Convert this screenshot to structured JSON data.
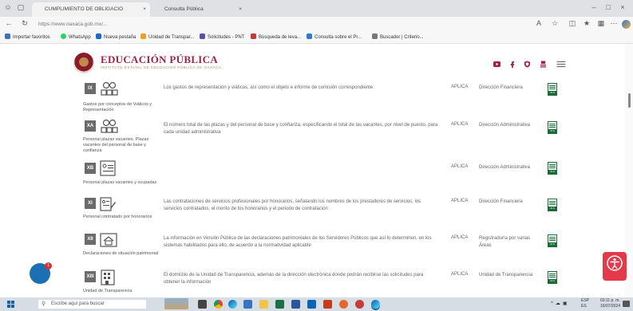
{
  "browser": {
    "tabs": [
      {
        "label": "CUMPLIMIENTO DE OBLIGACIO"
      },
      {
        "label": "Consulta Pública"
      }
    ],
    "new_tab_label": "+",
    "url": "https://www.oaxaca.gob.mx/...",
    "bookmarks": [
      {
        "label": "Importar favoritos",
        "color": "#3b73b9"
      },
      {
        "label": "WhatsApp",
        "color": "#25d366"
      },
      {
        "label": "Nueva pestaña",
        "color": "#1e68c8"
      },
      {
        "label": "Unidad de Transpar...",
        "color": "#f0a020"
      },
      {
        "label": "Solicitudes - PNT",
        "color": "#5b4ea8"
      },
      {
        "label": "Búsqueda de leva...",
        "color": "#c23b3b"
      },
      {
        "label": "Consulta sobre el Pr...",
        "color": "#2f7acf"
      },
      {
        "label": "Buscador | Criterio...",
        "color": "#777777"
      }
    ]
  },
  "site": {
    "title": "EDUCACIÓN PÚBLICA",
    "subtitle": "INSTITUTO ESTATAL DE EDUCACIÓN PÚBLICA DE OAXACA"
  },
  "rows": [
    {
      "badge": "IX",
      "label": "Gastos por conceptos de Viáticos y Representación",
      "desc": "Los gastos de representación y viáticos, así como el objeto e informe de comisión correspondiente",
      "aplica": "APLICA",
      "area": "Dirección Financiera"
    },
    {
      "badge": "XA",
      "label": "Personal plazas vacantes. Plazas vacantes del personal de base y confianza",
      "desc": "El número total de las plazas y del personal de base y confianza, especificando el total de las vacantes, por nivel de puesto, para cada unidad administrativa",
      "aplica": "APLICA",
      "area": "Dirección Administrativa"
    },
    {
      "badge": "XB",
      "label": "Personal plazas vacantes y ocupadas",
      "desc": "",
      "aplica": "APLICA",
      "area": "Dirección Administrativa"
    },
    {
      "badge": "XI",
      "label": "Personal contratado por honorarios",
      "desc": "Las contrataciones de servicios profesionales por honorarios, señalando los nombres de los prestadores de servicios, los servicios contratados, el monto de los honorarios y el periodo de contratación",
      "aplica": "APLICA",
      "area": "Dirección Financiera"
    },
    {
      "badge": "XII",
      "label": "Declaraciones de situación patrimonial",
      "desc": "La información en Versión Pública de las declaraciones patrimoniales de los Servidores Públicos que así lo determinen, en los sistemas habilitados para ello, de acuerdo a la normatividad aplicable",
      "aplica": "APLICA",
      "area": "Registraduría por varias Áreas"
    },
    {
      "badge": "XIII",
      "label": "Unidad de Transparencia",
      "desc": "El domicilio de la Unidad de Transparencia, además de la dirección electrónica donde podrán recibirse las solicitudes para obtener la información",
      "aplica": "APLICA",
      "area": "Unidad de Transparencia"
    }
  ],
  "xls_label": "XLS",
  "chat_badge": "1",
  "taskbar": {
    "search_placeholder": "Escribe aquí para buscar",
    "lang": "ESP\nES",
    "time": "03:11 p. m.",
    "date": "16/07/2024"
  },
  "colors": {
    "brand": "#9d2449",
    "gold": "#b38e5d",
    "xls_green": "#1b6b39"
  }
}
